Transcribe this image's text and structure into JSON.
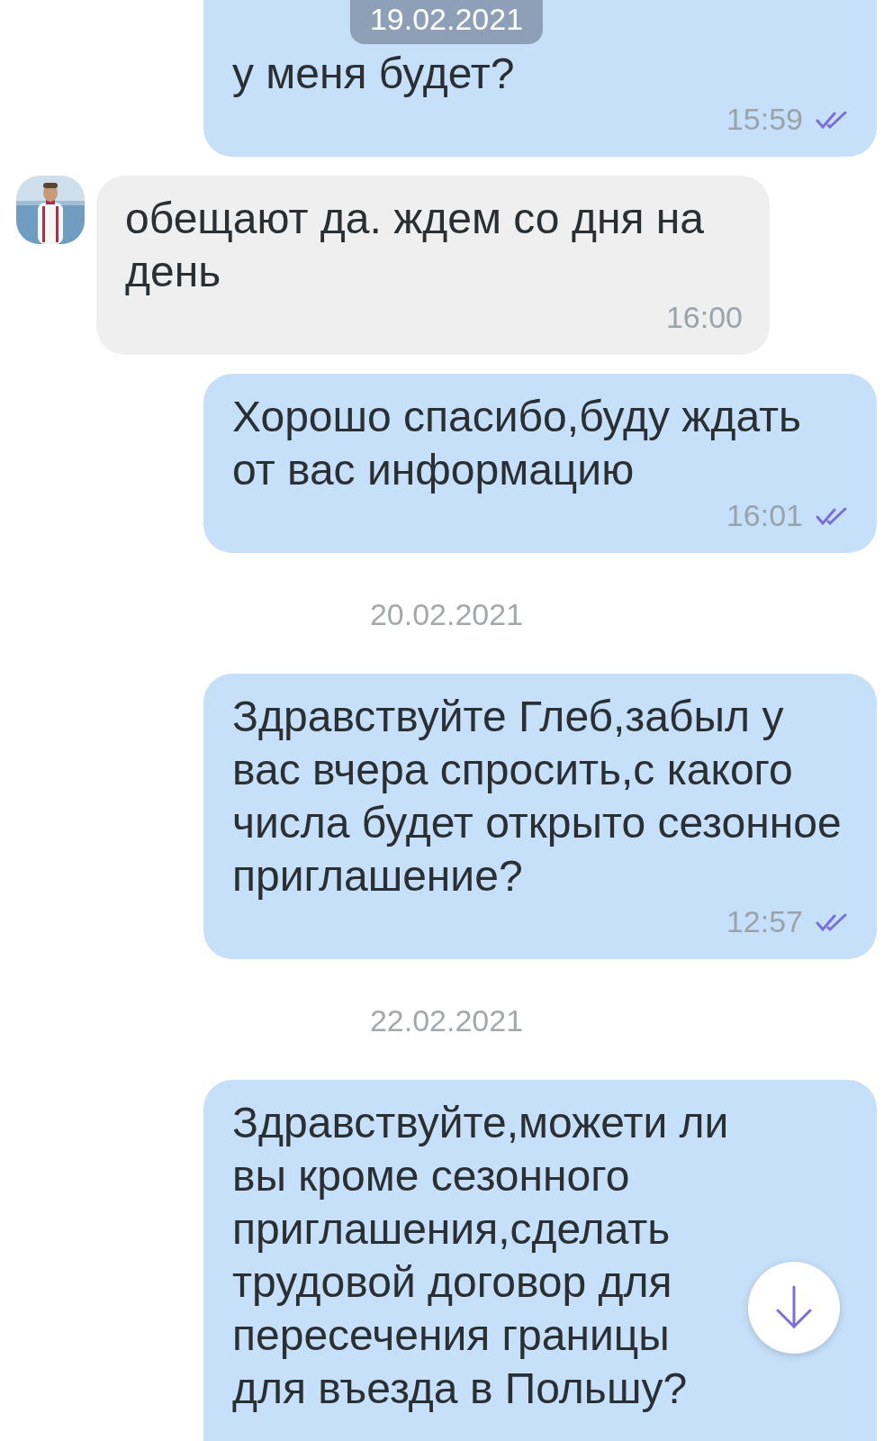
{
  "sticky_date": "19.02.2021",
  "messages": [
    {
      "kind": "outgoing",
      "text": "у меня будет?",
      "time": "15:59",
      "read": true
    },
    {
      "kind": "incoming",
      "text": "обещают да. ждем со дня на день",
      "time": "16:00"
    },
    {
      "kind": "outgoing",
      "text": "Хорошо спасибо,буду ждать от вас информацию",
      "time": "16:01",
      "read": true
    },
    {
      "kind": "date",
      "text": "20.02.2021"
    },
    {
      "kind": "outgoing",
      "text": "Здравствуйте Глеб,забыл у вас вчера спросить,с какого числа будет открыто сезонное приглашение?",
      "time": "12:57",
      "read": true
    },
    {
      "kind": "date",
      "text": "22.02.2021"
    },
    {
      "kind": "outgoing",
      "text": "Здравствуйте,можети ли вы кроме сезонного приглашения,сделать трудовой договор для пересечения границы для въезда в Польшу?"
    }
  ]
}
